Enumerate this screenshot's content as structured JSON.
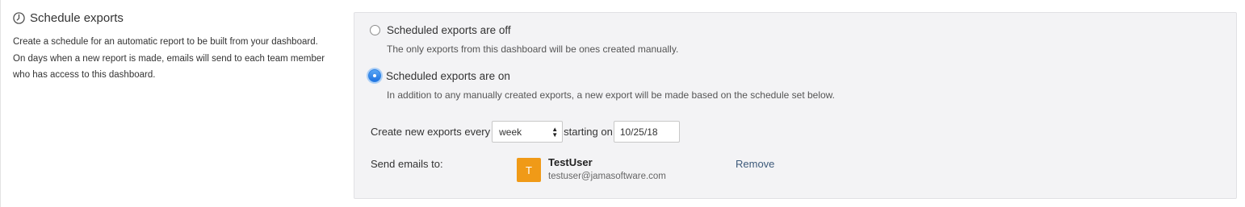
{
  "section": {
    "icon": "clock-icon",
    "title": "Schedule exports",
    "description": "Create a schedule for an automatic report to be built from your dashboard.\nOn days when a new report is made, emails will send to each team member\nwho has access to this dashboard."
  },
  "options": {
    "off": {
      "label": "Scheduled exports are off",
      "description": "The only exports from this dashboard will be ones created manually.",
      "selected": false
    },
    "on": {
      "label": "Scheduled exports are on",
      "description": "In addition to any manually created exports, a new export will be made based on the schedule set below.",
      "selected": true
    }
  },
  "schedule": {
    "every_label": "Create new exports every",
    "frequency_value": "week",
    "starting_label": "starting on",
    "start_date": "10/25/18"
  },
  "recipients": {
    "label": "Send emails to:",
    "users": [
      {
        "initial": "T",
        "name": "TestUser",
        "email": "testuser@jamasoftware.com",
        "remove_label": "Remove",
        "avatar_color": "#f09a17"
      }
    ]
  },
  "colors": {
    "panel_bg": "#f3f3f5",
    "radio_selected": "#2e83e6",
    "link": "#3d5a7a"
  }
}
